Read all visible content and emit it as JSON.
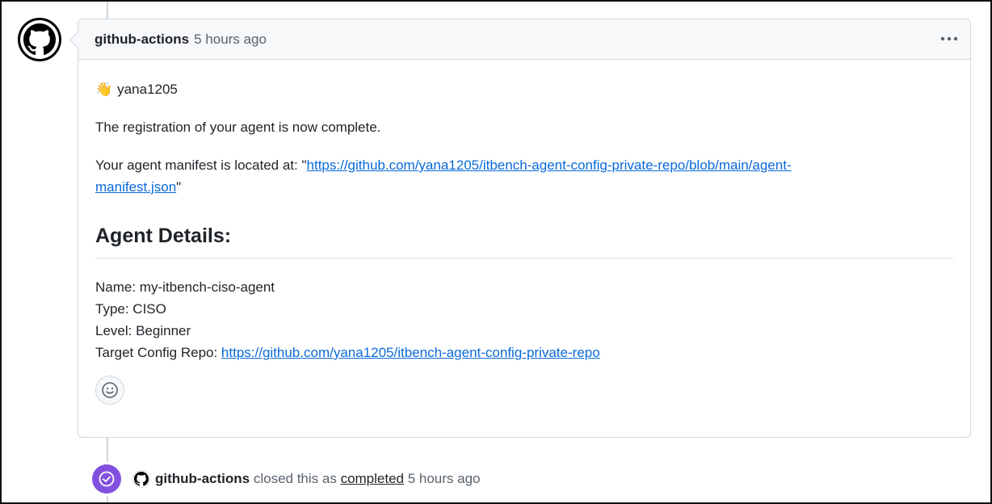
{
  "comment": {
    "author": "github-actions",
    "timestamp": "5 hours ago",
    "menu_icon": "kebab-horizontal-icon",
    "greeting_emoji": "👋",
    "greeting_user": "yana1205",
    "registration_text": "The registration of your agent is now complete.",
    "manifest_prefix": "Your agent manifest is located at: \"",
    "manifest_link_line1": "https://github.com/yana1205/itbench-agent-config-private-repo/blob/main/agent-",
    "manifest_link_line2": "manifest.json",
    "manifest_suffix": "\"",
    "details_heading": "Agent Details:",
    "details": {
      "name": "Name: my-itbench-ciso-agent",
      "type": "Type: CISO",
      "level": "Level: Beginner"
    },
    "target_label": "Target Config Repo: ",
    "target_link": "https://github.com/yana1205/itbench-agent-config-private-repo",
    "reaction_icon": "smiley-icon"
  },
  "event": {
    "icon": "check-circle-icon",
    "badge_color": "#8250df",
    "author": "github-actions",
    "action_text": " closed this as ",
    "state_link": "completed",
    "timestamp": " 5 hours ago"
  },
  "colors": {
    "link": "#0969da",
    "header_bg": "#f6f8fa",
    "border": "#d0d7de"
  }
}
